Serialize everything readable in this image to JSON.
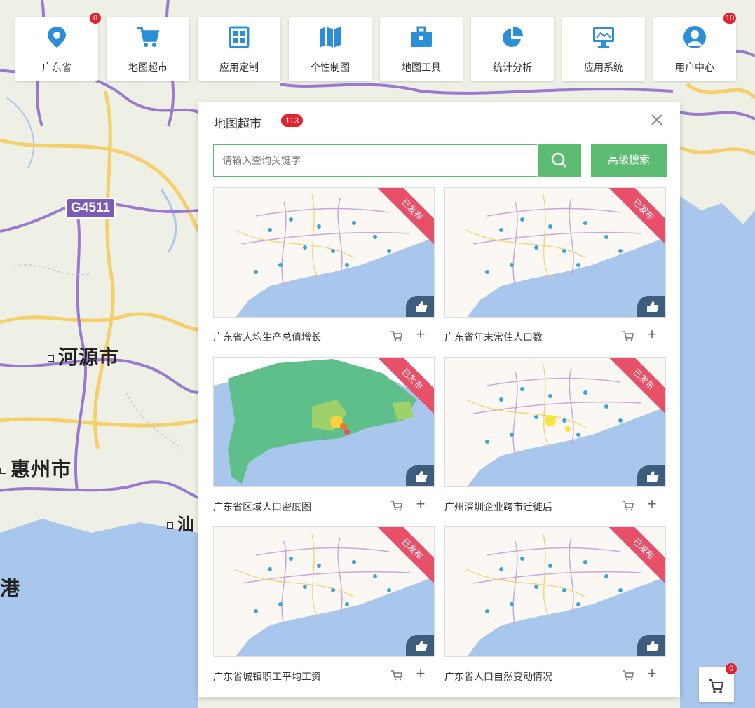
{
  "toolbar": {
    "items": [
      {
        "label": "广东省",
        "icon": "location-pin-icon",
        "badge": "0"
      },
      {
        "label": "地图超市",
        "icon": "shopping-cart-icon"
      },
      {
        "label": "应用定制",
        "icon": "app-grid-icon"
      },
      {
        "label": "个性制图",
        "icon": "folded-map-icon"
      },
      {
        "label": "地图工具",
        "icon": "toolbox-icon"
      },
      {
        "label": "统计分析",
        "icon": "pie-chart-icon"
      },
      {
        "label": "应用系统",
        "icon": "monitor-icon"
      },
      {
        "label": "用户中心",
        "icon": "user-icon",
        "badge": "10"
      }
    ]
  },
  "map": {
    "labels": {
      "heyuan": "河源市",
      "huizhou": "惠州市",
      "gang": "港",
      "shan_fragment": "汕"
    },
    "road_shield": "G4511"
  },
  "panel": {
    "title": "地图超市",
    "count": "113",
    "search_placeholder": "请输入查询关键字",
    "advanced_search": "高级搜索",
    "cards": [
      {
        "title": "广东省人均生产总值增长",
        "ribbon": "已发布",
        "style": "base"
      },
      {
        "title": "广东省年末常住人口数",
        "ribbon": "已发布",
        "style": "base"
      },
      {
        "title": "广东省区域人口密度图",
        "ribbon": "已发布",
        "style": "density"
      },
      {
        "title": "广州深圳企业跨市迁徙后",
        "ribbon": "已发布",
        "style": "yellow"
      },
      {
        "title": "广东省城镇职工平均工资",
        "ribbon": "已发布",
        "style": "base"
      },
      {
        "title": "广东省人口自然变动情况",
        "ribbon": "已发布",
        "style": "base"
      }
    ]
  },
  "float_cart": {
    "badge": "0",
    "icon": "cart-icon"
  },
  "colors": {
    "accent": "#5cbc72",
    "badge": "#e5202b",
    "ribbon": "#e8506a",
    "icon_blue": "#2a8fd6"
  }
}
